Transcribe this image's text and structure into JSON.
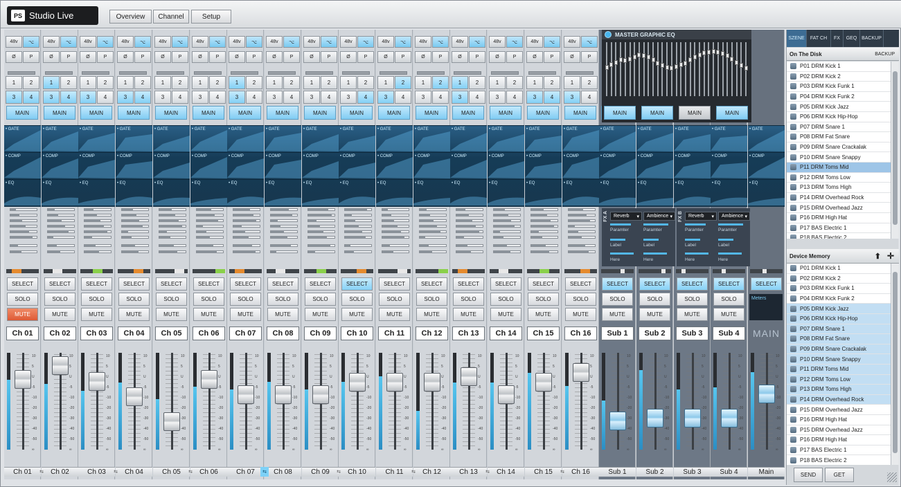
{
  "app": {
    "name": "Studio Live",
    "logo_mark": "PS"
  },
  "nav": [
    "Overview",
    "Channel",
    "Setup"
  ],
  "labels": {
    "p48": "48v",
    "phase": "Ø",
    "polarity": "P",
    "main": "MAIN",
    "gate": "• GATE",
    "comp": "• COMP",
    "eq": "• EQ",
    "select": "SELECT",
    "solo": "SOLO",
    "mute": "MUTE",
    "meters": "Meters",
    "main_logo": "MAIN",
    "link": "⇆"
  },
  "channels": [
    {
      "name": "Ch 01",
      "mute": true,
      "select": false,
      "meter": 0.72,
      "fader": 0.73
    },
    {
      "name": "Ch 02",
      "mute": false,
      "select": false,
      "meter": 0.68,
      "fader": 0.87
    },
    {
      "name": "Ch 03",
      "mute": false,
      "select": false,
      "meter": 0.61,
      "fader": 0.71
    },
    {
      "name": "Ch 04",
      "mute": false,
      "select": false,
      "meter": 0.69,
      "fader": 0.55
    },
    {
      "name": "Ch 05",
      "mute": false,
      "select": false,
      "meter": 0.52,
      "fader": 0.29
    },
    {
      "name": "Ch 06",
      "mute": false,
      "select": false,
      "meter": 0.65,
      "fader": 0.73
    },
    {
      "name": "Ch 07",
      "mute": false,
      "select": false,
      "meter": 0.62,
      "fader": 0.57
    },
    {
      "name": "Ch 08",
      "mute": false,
      "select": false,
      "meter": 0.7,
      "fader": 0.57
    },
    {
      "name": "Ch 09",
      "mute": false,
      "select": false,
      "meter": 0.62,
      "fader": 0.57
    },
    {
      "name": "Ch 10",
      "mute": false,
      "select": true,
      "meter": 0.7,
      "fader": 0.7
    },
    {
      "name": "Ch 11",
      "mute": false,
      "select": false,
      "meter": 0.76,
      "fader": 0.7
    },
    {
      "name": "Ch 12",
      "mute": false,
      "select": false,
      "meter": 0.4,
      "fader": 0.7
    },
    {
      "name": "Ch 13",
      "mute": false,
      "select": false,
      "meter": 0.69,
      "fader": 0.76
    },
    {
      "name": "Ch 14",
      "mute": false,
      "select": false,
      "meter": 0.69,
      "fader": 0.57
    },
    {
      "name": "Ch 15",
      "mute": false,
      "select": false,
      "meter": 0.79,
      "fader": 0.7
    },
    {
      "name": "Ch 16",
      "mute": false,
      "select": false,
      "meter": 0.66,
      "fader": 0.8
    }
  ],
  "subs": [
    {
      "name": "Sub 1",
      "meter": 0.51,
      "fader": 0.3
    },
    {
      "name": "Sub 2",
      "meter": 0.82,
      "fader": 0.33
    },
    {
      "name": "Sub 3",
      "meter": 0.62,
      "fader": 0.33
    },
    {
      "name": "Sub 4",
      "meter": 0.64,
      "fader": 0.33
    },
    {
      "name": "Main",
      "meter": 0.8,
      "fader": 0.58
    }
  ],
  "bottom_names": [
    "Ch 01",
    "Ch 02",
    "Ch 03",
    "Ch 04",
    "Ch 05",
    "Ch 06",
    "Ch 07",
    "Ch 08",
    "Ch 09",
    "Ch 10",
    "Ch 11",
    "Ch 12",
    "Ch 13",
    "Ch 14",
    "Ch 15",
    "Ch 16",
    "Sub 1",
    "Sub 2",
    "Sub 3",
    "Sub 4",
    "Main"
  ],
  "geq": {
    "title": "MASTER GRAPHIC EQ",
    "bands": [
      0.48,
      0.42,
      0.36,
      0.3,
      0.32,
      0.28,
      0.24,
      0.18,
      0.2,
      0.23,
      0.3,
      0.38,
      0.44,
      0.48,
      0.5,
      0.46,
      0.42,
      0.38,
      0.3,
      0.24,
      0.18,
      0.14,
      0.11,
      0.1,
      0.12,
      0.15,
      0.2,
      0.28,
      0.36,
      0.44,
      0.5
    ]
  },
  "fx": {
    "a": "FX A",
    "b": "FX B",
    "slots": [
      {
        "type": "Reverb",
        "param": "Paramter",
        "label": "Label",
        "here": "Here"
      },
      {
        "type": "Ambience",
        "param": "Paramter",
        "label": "Label",
        "here": "Here"
      },
      {
        "type": "Reverb",
        "param": "Paramter",
        "label": "Label",
        "here": "Here"
      },
      {
        "type": "Ambience",
        "param": "Paramter",
        "label": "Label",
        "here": "Here"
      }
    ]
  },
  "scale": [
    "10",
    "5",
    "U",
    "-5",
    "-10",
    "-20",
    "-30",
    "-40",
    "-50",
    "∞"
  ],
  "right": {
    "tabs": [
      "SZENE",
      "FAT CH",
      "FX",
      "GEQ",
      "BACKUP"
    ],
    "disk_title": "On The Disk",
    "disk_backup": "BACKUP",
    "disk_items": [
      "P01 DRM Kick 1",
      "P02 DRM Kick 2",
      "P03 DRM Kick Funk 1",
      "P04 DRM Kick Funk 2",
      "P05 DRM Kick Jazz",
      "P06 DRM Kick Hip-Hop",
      "P07 DRM Snare 1",
      "P08 DRM Fat Snare",
      "P09 DRM Snare Crackalak",
      "P10 DRM Snare Snappy",
      "P11 DRM Toms Mid",
      "P12 DRM Toms Low",
      "P13 DRM Toms High",
      "P14 DRM Overhead Rock",
      "P15 DRM Overhead Jazz",
      "P16 DRM High Hat",
      "P17 BAS Electric 1",
      "P18 BAS Electric 2"
    ],
    "disk_highlight": 10,
    "device_title": "Device Memory",
    "device_items": [
      "P01 DRM Kick 1",
      "P02 DRM Kick 2",
      "P03 DRM Kick Funk 1",
      "P04 DRM Kick Funk 2",
      "P05 DRM Kick Jazz",
      "P06 DRM Kick Hip-Hop",
      "P07 DRM Snare 1",
      "P08 DRM Fat Snare",
      "P09 DRM Snare Crackalak",
      "P10 DRM Snare Snappy",
      "P11 DRM Toms Mid",
      "P12 DRM Toms Low",
      "P13 DRM Toms High",
      "P14 DRM Overhead Rock",
      "P15 DRM Overhead Jazz",
      "P16 DRM High Hat",
      "P15 DRM Overhead Jazz",
      "P16 DRM High Hat",
      "P17 BAS Electric 1",
      "P18 BAS Electric 2"
    ],
    "device_blue_from": 4,
    "device_blue_to": 13,
    "send": "SEND",
    "get": "GET"
  }
}
